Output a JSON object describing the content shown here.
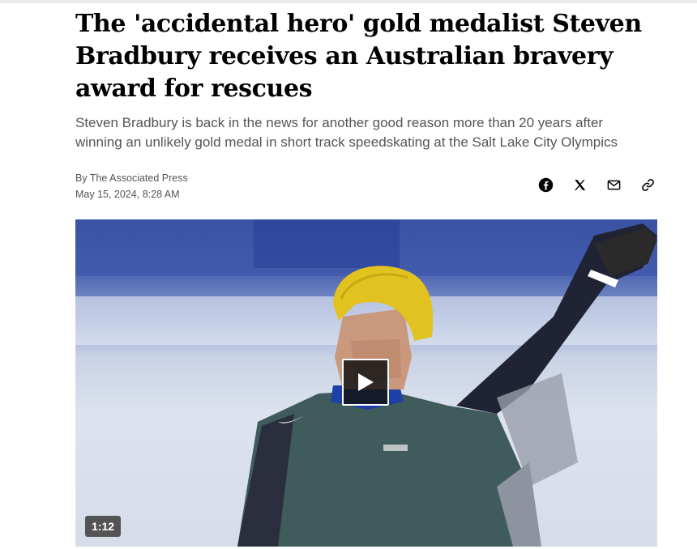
{
  "article": {
    "headline": "The 'accidental hero' gold medalist Steven Bradbury receives an Australian bravery award for rescues",
    "dek": "Steven Bradbury is back in the news for another good reason more than 20 years after winning an unlikely gold medal in short track speedskating at the Salt Lake City Olympics",
    "byline": "By The Associated Press",
    "timestamp": "May 15, 2024, 8:28 AM"
  },
  "share": {
    "icons": [
      "facebook-icon",
      "x-icon",
      "mail-icon",
      "link-icon"
    ]
  },
  "media": {
    "duration": "1:12",
    "play_icon": "play-icon"
  }
}
